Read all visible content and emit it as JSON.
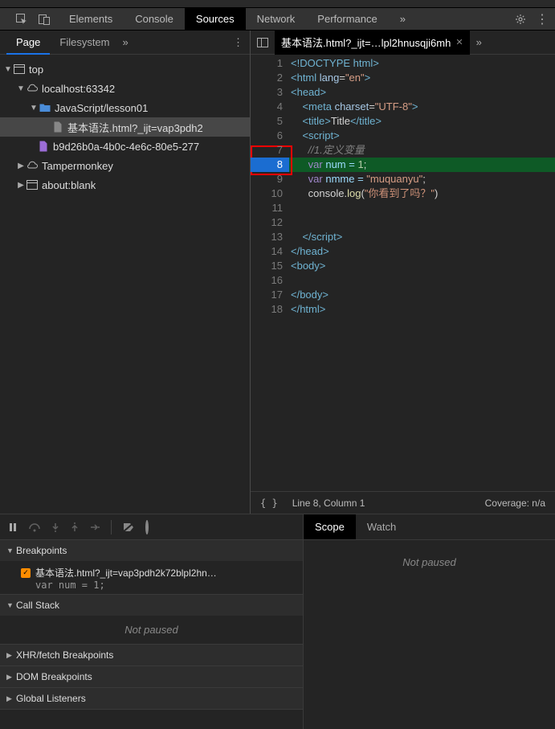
{
  "main_tabs": {
    "elements": "Elements",
    "console": "Console",
    "sources": "Sources",
    "network": "Network",
    "performance": "Performance"
  },
  "sub_tabs": {
    "page": "Page",
    "filesystem": "Filesystem"
  },
  "tree": {
    "top": "top",
    "host": "localhost:63342",
    "folder": "JavaScript/lesson01",
    "file1": "基本语法.html?_ijt=vap3pdh2",
    "file2": "b9d26b0a-4b0c-4e6c-80e5-277",
    "tampermonkey": "Tampermonkey",
    "about": "about:blank"
  },
  "file_tab": {
    "name": "基本语法.html?_ijt=…lpl2hnusqji6mh"
  },
  "code": {
    "l1": "<!DOCTYPE html>",
    "l2a": "<html ",
    "l2b": "lang",
    "l2c": "=",
    "l2d": "\"en\"",
    "l2e": ">",
    "l3": "<head>",
    "l4a": "    <meta ",
    "l4b": "charset",
    "l4c": "=",
    "l4d": "\"UTF-8\"",
    "l4e": ">",
    "l5a": "    <title>",
    "l5b": "Title",
    "l5c": "</title>",
    "l6": "    <script>",
    "l7": "      //1.定义变量",
    "l8a": "      var",
    "l8b": " num = ",
    "l8c": "1",
    "l8d": ";",
    "l9a": "      var",
    "l9b": " nmme = ",
    "l9c": "\"muquanyu\"",
    "l9d": ";",
    "l10a": "      console.",
    "l10b": "log",
    "l10c": "(",
    "l10d": "\"你看到了吗？\"",
    "l10e": ")",
    "l13": "    </script>",
    "l14": "</head>",
    "l15": "<body>",
    "l17": "</body>",
    "l18": "</html>"
  },
  "line_numbers": [
    "1",
    "2",
    "3",
    "4",
    "5",
    "6",
    "7",
    "8",
    "9",
    "10",
    "11",
    "12",
    "13",
    "14",
    "15",
    "16",
    "17",
    "18"
  ],
  "status": {
    "pos": "Line 8, Column 1",
    "coverage": "Coverage: n/a"
  },
  "debug": {
    "breakpoints_h": "Breakpoints",
    "bp_file": "基本语法.html?_ijt=vap3pdh2k72blpl2hn…",
    "bp_code": "var num = 1;",
    "callstack_h": "Call Stack",
    "not_paused": "Not paused",
    "xhr_h": "XHR/fetch Breakpoints",
    "dom_h": "DOM Breakpoints",
    "global_h": "Global Listeners",
    "scope_tab": "Scope",
    "watch_tab": "Watch",
    "scope_body": "Not paused"
  }
}
